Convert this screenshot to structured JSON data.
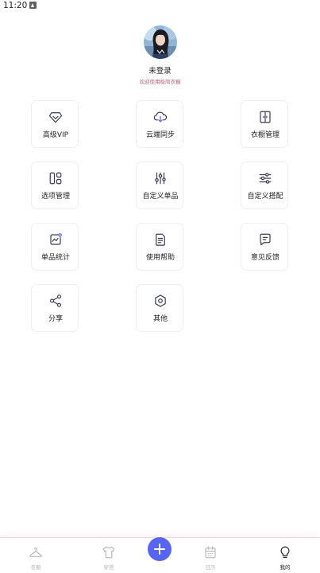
{
  "status_bar": {
    "time": "11:20"
  },
  "profile": {
    "username": "未登录",
    "welcome": "欢迎使用极简衣橱"
  },
  "grid": [
    {
      "label": "高级VIP",
      "icon": "diamond-icon"
    },
    {
      "label": "云端同步",
      "icon": "cloud-sync-icon"
    },
    {
      "label": "衣橱管理",
      "icon": "wardrobe-icon"
    },
    {
      "label": "选项管理",
      "icon": "layout-icon"
    },
    {
      "label": "自定义单品",
      "icon": "vertical-sliders-icon"
    },
    {
      "label": "自定义搭配",
      "icon": "horizontal-sliders-icon"
    },
    {
      "label": "单品统计",
      "icon": "chart-icon"
    },
    {
      "label": "使用帮助",
      "icon": "document-icon"
    },
    {
      "label": "意见反馈",
      "icon": "message-icon"
    },
    {
      "label": "分享",
      "icon": "share-icon"
    },
    {
      "label": "其他",
      "icon": "settings-icon"
    }
  ],
  "bottom_nav": [
    {
      "label": "衣橱",
      "icon": "hanger-icon",
      "active": false
    },
    {
      "label": "穿搭",
      "icon": "tshirt-icon",
      "active": false
    },
    {
      "label": "",
      "icon": "plus-icon",
      "active": false
    },
    {
      "label": "日历",
      "icon": "calendar-icon",
      "active": false
    },
    {
      "label": "我的",
      "icon": "lightbulb-icon",
      "active": true
    }
  ],
  "colors": {
    "accent": "#5865f2",
    "icon": "#3a3d56",
    "welcome": "#b0657a",
    "inactive": "#b7b7b7"
  }
}
